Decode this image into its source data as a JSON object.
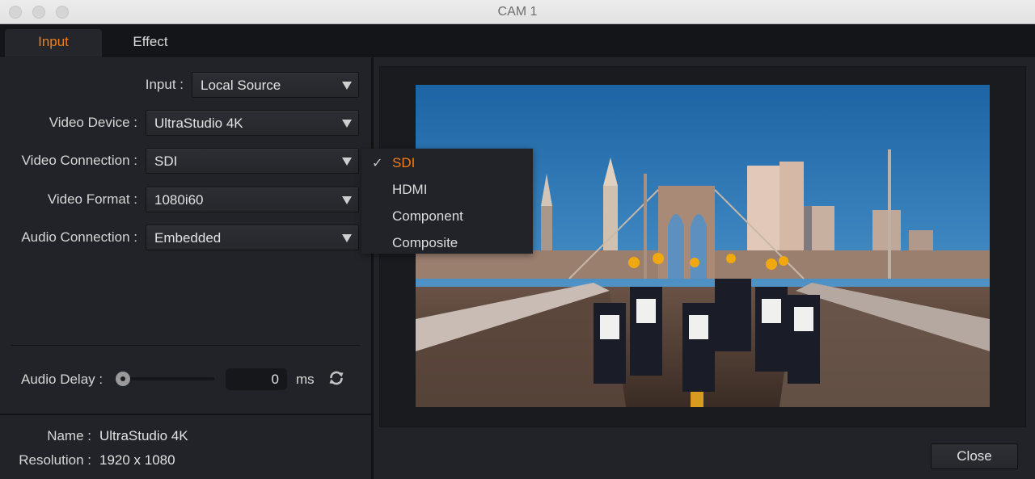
{
  "window": {
    "title": "CAM 1"
  },
  "tabs": [
    {
      "label": "Input",
      "active": true
    },
    {
      "label": "Effect",
      "active": false
    }
  ],
  "form": {
    "input": {
      "label": "Input :",
      "value": "Local Source"
    },
    "video_device": {
      "label": "Video Device :",
      "value": "UltraStudio 4K"
    },
    "video_connection": {
      "label": "Video Connection :",
      "value": "SDI"
    },
    "video_format": {
      "label": "Video Format :",
      "value": "1080i60"
    },
    "audio_connection": {
      "label": "Audio Connection :",
      "value": "Embedded"
    }
  },
  "video_connection_menu": {
    "items": [
      {
        "label": "SDI",
        "selected": true,
        "check": "✓"
      },
      {
        "label": "HDMI",
        "selected": false
      },
      {
        "label": "Component",
        "selected": false
      },
      {
        "label": "Composite",
        "selected": false
      }
    ]
  },
  "audio_delay": {
    "label": "Audio Delay :",
    "slider_fraction": 0,
    "value": "0",
    "unit": "ms",
    "reset_icon": "refresh-icon"
  },
  "info": {
    "name_label": "Name :",
    "name_value": "UltraStudio 4K",
    "resolution_label": "Resolution :",
    "resolution_value": "1920 x 1080"
  },
  "preview": {
    "description": "Marching band on the Brooklyn Bridge with Manhattan skyline"
  },
  "buttons": {
    "close": "Close"
  },
  "colors": {
    "accent": "#f07d15",
    "panel": "#222328",
    "tabbar": "#141519"
  }
}
